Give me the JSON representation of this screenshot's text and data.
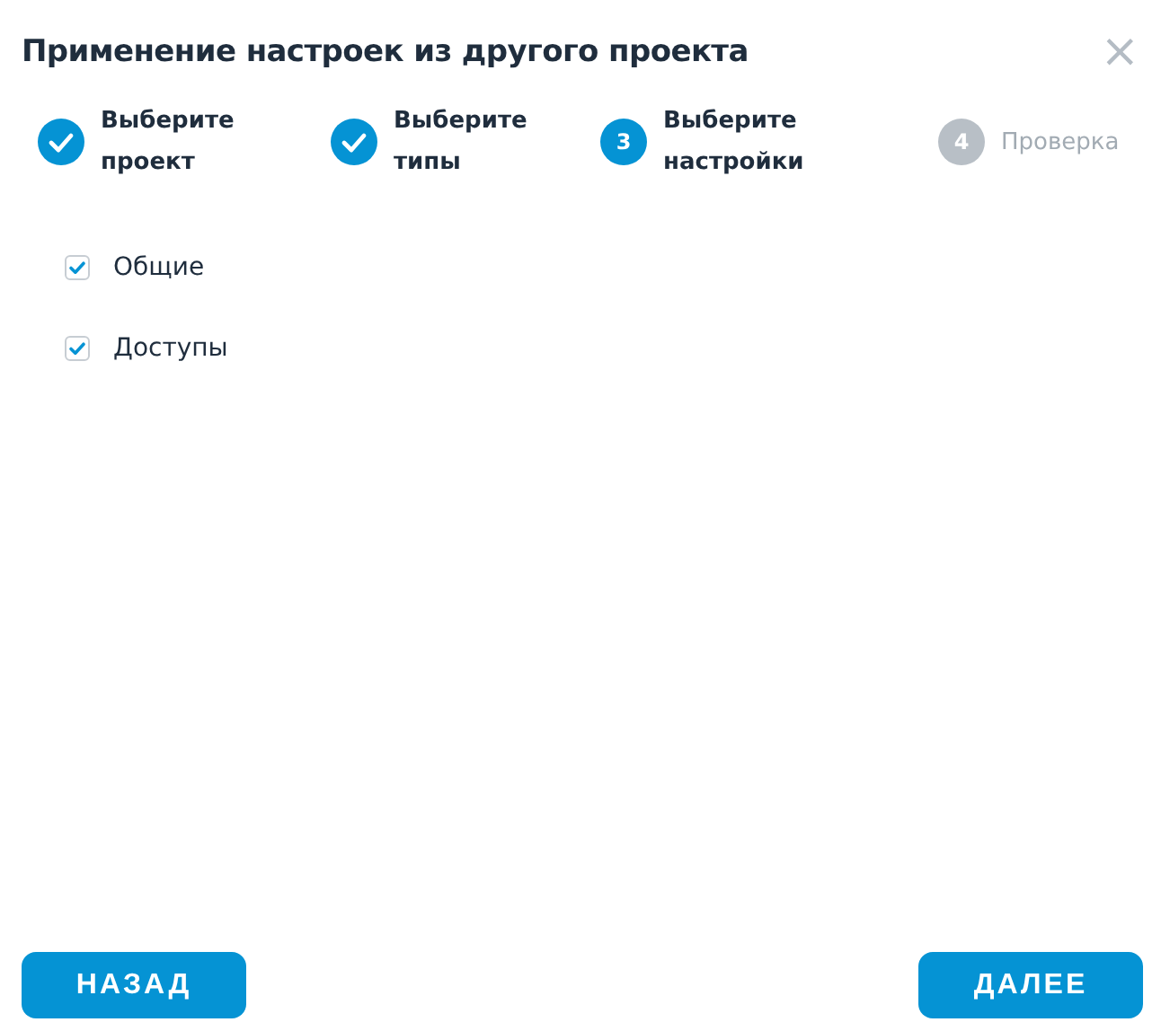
{
  "dialog": {
    "title": "Применение настроек из другого проекта",
    "close": "×"
  },
  "steps": [
    {
      "kind": "done",
      "label": "Выберите проект"
    },
    {
      "kind": "done",
      "label": "Выберите типы"
    },
    {
      "kind": "current",
      "number": "3",
      "label": "Выберите настройки"
    },
    {
      "kind": "pending",
      "number": "4",
      "label": "Проверка"
    }
  ],
  "options": [
    {
      "label": "Общие",
      "checked": true
    },
    {
      "label": "Доступы",
      "checked": true
    }
  ],
  "buttons": {
    "back": "НАЗАД",
    "next": "ДАЛЕЕ"
  }
}
